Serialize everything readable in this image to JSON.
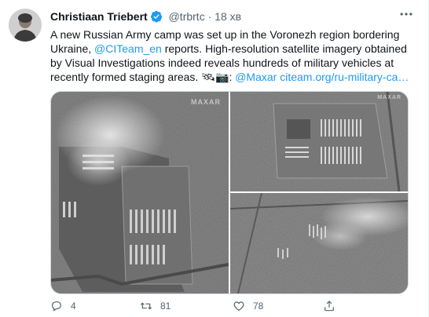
{
  "tweet": {
    "author_name": "Christiaan Triebert",
    "handle": "@trbrtc",
    "separator": "·",
    "time": "18 хв",
    "text_1": "A new Russian Army camp was set up in the Voronezh region bordering Ukraine, ",
    "mention": "@CITeam_en",
    "text_2": " reports. High-resolution satellite imagery obtained by Visual Investigations indeed reveals hundreds of military vehicles at recently formed staging areas. ",
    "emoji_icons": "🛰📷",
    "text_3": ": ",
    "mention_2": "@Maxar",
    "link": "citeam.org/ru-military-ca…",
    "watermark": "MAXAR"
  },
  "actions": {
    "reply_count": "4",
    "retweet_count": "81",
    "like_count": "78"
  },
  "colors": {
    "link": "#1d9bf0",
    "verified": "#1d9bf0",
    "secondary_text": "#536471"
  }
}
